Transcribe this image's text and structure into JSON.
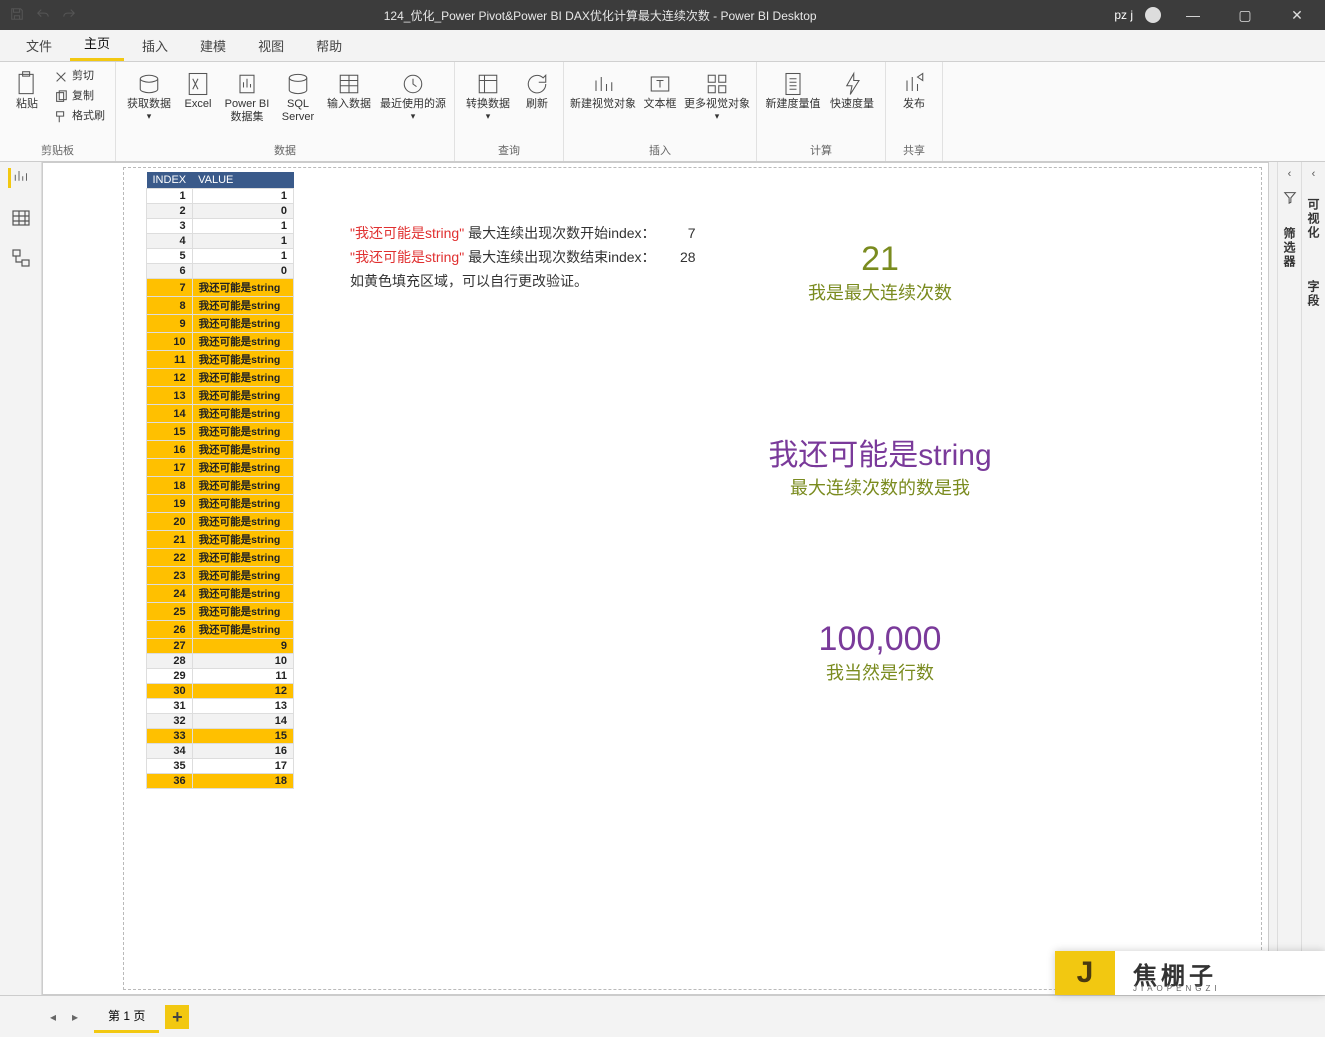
{
  "titlebar": {
    "title": "124_优化_Power Pivot&Power BI DAX优化计算最大连续次数 - Power BI Desktop",
    "user": "pz j"
  },
  "tabs": [
    "文件",
    "主页",
    "插入",
    "建模",
    "视图",
    "帮助"
  ],
  "activeTab": 1,
  "ribbon": {
    "clipboard": {
      "paste": "粘贴",
      "cut": "剪切",
      "copy": "复制",
      "format": "格式刷",
      "group": "剪贴板"
    },
    "data": {
      "get": "获取数据",
      "excel": "Excel",
      "pbi_ds": "Power BI 数据集",
      "sql": "SQL Server",
      "enter": "输入数据",
      "recent": "最近使用的源",
      "group": "数据"
    },
    "query": {
      "transform": "转换数据",
      "refresh": "刷新",
      "group": "查询"
    },
    "insert": {
      "newvis": "新建视觉对象",
      "textbox": "文本框",
      "morevis": "更多视觉对象",
      "group": "插入"
    },
    "calc": {
      "newmeasure": "新建度量值",
      "quickmeasure": "快速度量",
      "group": "计算"
    },
    "share": {
      "publish": "发布",
      "group": "共享"
    }
  },
  "table": {
    "headers": [
      "INDEX",
      "VALUE"
    ],
    "rows": [
      {
        "i": 1,
        "v": "1",
        "hl": false,
        "alt": false
      },
      {
        "i": 2,
        "v": "0",
        "hl": false,
        "alt": true
      },
      {
        "i": 3,
        "v": "1",
        "hl": false,
        "alt": false
      },
      {
        "i": 4,
        "v": "1",
        "hl": false,
        "alt": true
      },
      {
        "i": 5,
        "v": "1",
        "hl": false,
        "alt": false
      },
      {
        "i": 6,
        "v": "0",
        "hl": false,
        "alt": true
      },
      {
        "i": 7,
        "v": "我还可能是string",
        "hl": true,
        "str": true
      },
      {
        "i": 8,
        "v": "我还可能是string",
        "hl": true,
        "str": true
      },
      {
        "i": 9,
        "v": "我还可能是string",
        "hl": true,
        "str": true
      },
      {
        "i": 10,
        "v": "我还可能是string",
        "hl": true,
        "str": true
      },
      {
        "i": 11,
        "v": "我还可能是string",
        "hl": true,
        "str": true
      },
      {
        "i": 12,
        "v": "我还可能是string",
        "hl": true,
        "str": true
      },
      {
        "i": 13,
        "v": "我还可能是string",
        "hl": true,
        "str": true
      },
      {
        "i": 14,
        "v": "我还可能是string",
        "hl": true,
        "str": true
      },
      {
        "i": 15,
        "v": "我还可能是string",
        "hl": true,
        "str": true
      },
      {
        "i": 16,
        "v": "我还可能是string",
        "hl": true,
        "str": true
      },
      {
        "i": 17,
        "v": "我还可能是string",
        "hl": true,
        "str": true
      },
      {
        "i": 18,
        "v": "我还可能是string",
        "hl": true,
        "str": true
      },
      {
        "i": 19,
        "v": "我还可能是string",
        "hl": true,
        "str": true
      },
      {
        "i": 20,
        "v": "我还可能是string",
        "hl": true,
        "str": true
      },
      {
        "i": 21,
        "v": "我还可能是string",
        "hl": true,
        "str": true
      },
      {
        "i": 22,
        "v": "我还可能是string",
        "hl": true,
        "str": true
      },
      {
        "i": 23,
        "v": "我还可能是string",
        "hl": true,
        "str": true
      },
      {
        "i": 24,
        "v": "我还可能是string",
        "hl": true,
        "str": true
      },
      {
        "i": 25,
        "v": "我还可能是string",
        "hl": true,
        "str": true
      },
      {
        "i": 26,
        "v": "我还可能是string",
        "hl": true,
        "str": true
      },
      {
        "i": 27,
        "v": "9",
        "hl": true,
        "alt": false
      },
      {
        "i": 28,
        "v": "10",
        "hl": false,
        "alt": true
      },
      {
        "i": 29,
        "v": "11",
        "hl": false,
        "alt": false
      },
      {
        "i": 30,
        "v": "12",
        "hl": true,
        "alt": false
      },
      {
        "i": 31,
        "v": "13",
        "hl": false,
        "alt": false
      },
      {
        "i": 32,
        "v": "14",
        "hl": false,
        "alt": true
      },
      {
        "i": 33,
        "v": "15",
        "hl": true,
        "alt": false
      },
      {
        "i": 34,
        "v": "16",
        "hl": false,
        "alt": true
      },
      {
        "i": 35,
        "v": "17",
        "hl": false,
        "alt": false
      },
      {
        "i": 36,
        "v": "18",
        "hl": true,
        "alt": false
      }
    ]
  },
  "notes": {
    "p1a": "\"我还可能是string\"",
    "p1b": "最大连续出现次数开始index：",
    "p1v": "7",
    "p2a": "\"我还可能是string\"",
    "p2b": "最大连续出现次数结束index：",
    "p2v": "28",
    "p3": "如黄色填充区域，可以自行更改验证。"
  },
  "cards": {
    "c1": {
      "big": "21",
      "sub": "我是最大连续次数"
    },
    "c2": {
      "big": "我还可能是string",
      "sub": "最大连续次数的数是我"
    },
    "c3": {
      "big": "100,000",
      "sub": "我当然是行数"
    }
  },
  "rightpanes": {
    "filter": "筛选器",
    "viz": "可视化",
    "fields": "字段"
  },
  "footer": {
    "page": "第 1 页"
  },
  "logo": {
    "j": "J",
    "cn": "焦棚子",
    "py": "JIAOPENGZI"
  }
}
